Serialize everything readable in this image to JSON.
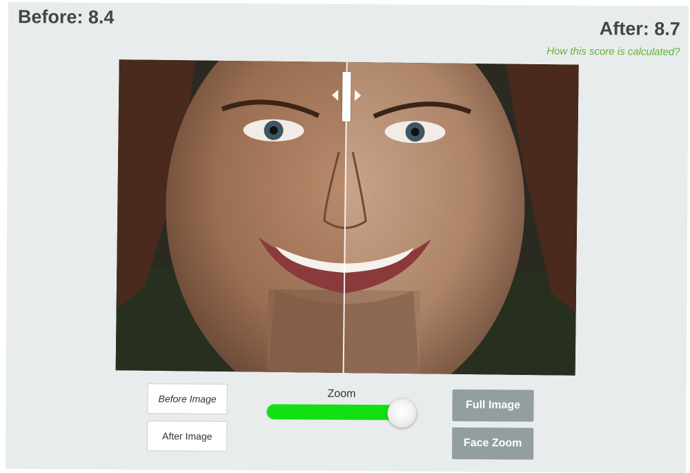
{
  "scores": {
    "before_label": "Before: 8.4",
    "after_label": "After: 8.7",
    "how_calculated_link": "How this score is calculated?"
  },
  "viewer": {
    "image_subject": "smiling woman portrait with freckles, split before/after comparison",
    "split_position_percent": 50
  },
  "buttons": {
    "before_image": "Before Image",
    "after_image": "After Image",
    "full_image": "Full Image",
    "face_zoom": "Face Zoom"
  },
  "zoom": {
    "label": "Zoom",
    "value_percent": 95
  },
  "colors": {
    "score_link": "#5fb336",
    "zoom_track": "#12e012",
    "gray_button": "#939e9e",
    "panel_bg": "#e9ecec"
  },
  "icons": {
    "split_handle": "drag-handle-icon",
    "left_arrow": "arrow-left-icon",
    "right_arrow": "arrow-right-icon"
  }
}
